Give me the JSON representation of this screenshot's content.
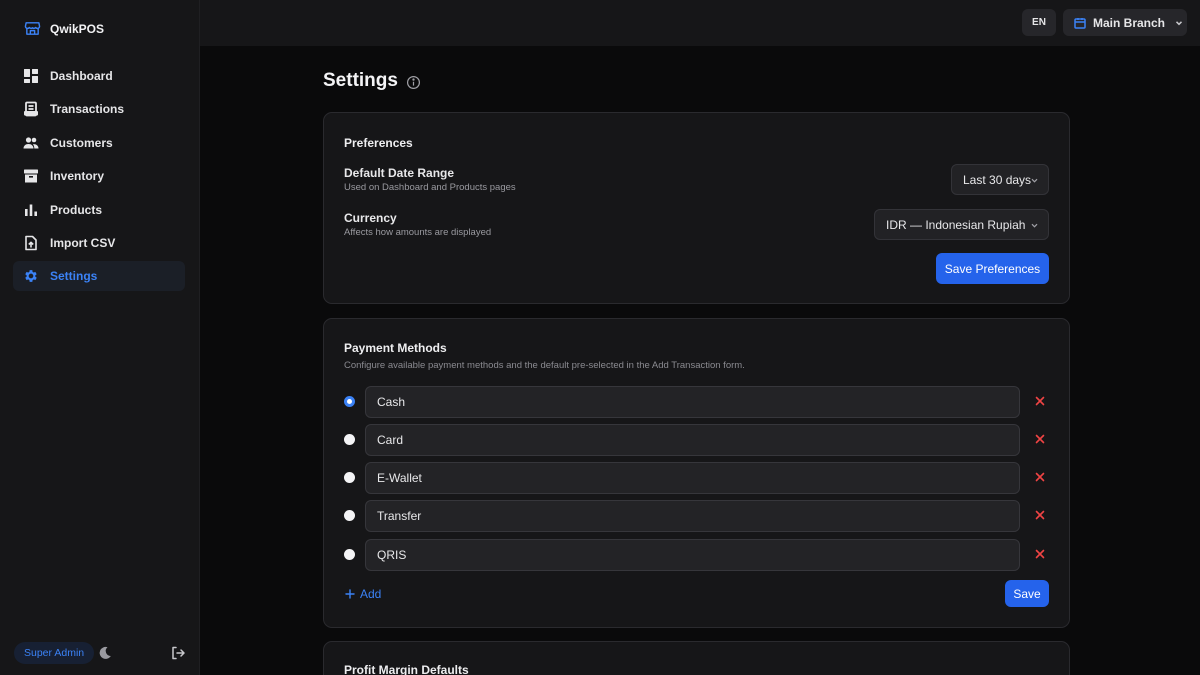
{
  "app": {
    "name": "QwikPOS"
  },
  "colors": {
    "accent": "#3b82f6",
    "primary_button": "#2563eb",
    "danger": "#ef4444"
  },
  "sidebar": {
    "items": [
      {
        "label": "Dashboard",
        "icon": "dashboard-icon",
        "active": false
      },
      {
        "label": "Transactions",
        "icon": "receipt-icon",
        "active": false
      },
      {
        "label": "Customers",
        "icon": "users-icon",
        "active": false
      },
      {
        "label": "Inventory",
        "icon": "archive-icon",
        "active": false
      },
      {
        "label": "Products",
        "icon": "bar-chart-icon",
        "active": false
      },
      {
        "label": "Import CSV",
        "icon": "file-upload-icon",
        "active": false
      },
      {
        "label": "Settings",
        "icon": "gear-icon",
        "active": true
      }
    ],
    "footer": {
      "role": "Super Admin"
    }
  },
  "topbar": {
    "language": "EN",
    "branch": "Main Branch"
  },
  "page": {
    "title": "Settings"
  },
  "preferences": {
    "title": "Preferences",
    "date_range": {
      "label": "Default Date Range",
      "description": "Used on Dashboard and Products pages",
      "value": "Last 30 days"
    },
    "currency": {
      "label": "Currency",
      "description": "Affects how amounts are displayed",
      "value": "IDR — Indonesian Rupiah"
    },
    "save_label": "Save Preferences"
  },
  "payment_methods": {
    "title": "Payment Methods",
    "description": "Configure available payment methods and the default pre-selected in the Add Transaction form.",
    "methods": [
      {
        "name": "Cash",
        "default": true
      },
      {
        "name": "Card",
        "default": false
      },
      {
        "name": "E-Wallet",
        "default": false
      },
      {
        "name": "Transfer",
        "default": false
      },
      {
        "name": "QRIS",
        "default": false
      }
    ],
    "add_label": "Add",
    "save_label": "Save"
  },
  "profit_margin": {
    "title": "Profit Margin Defaults"
  }
}
